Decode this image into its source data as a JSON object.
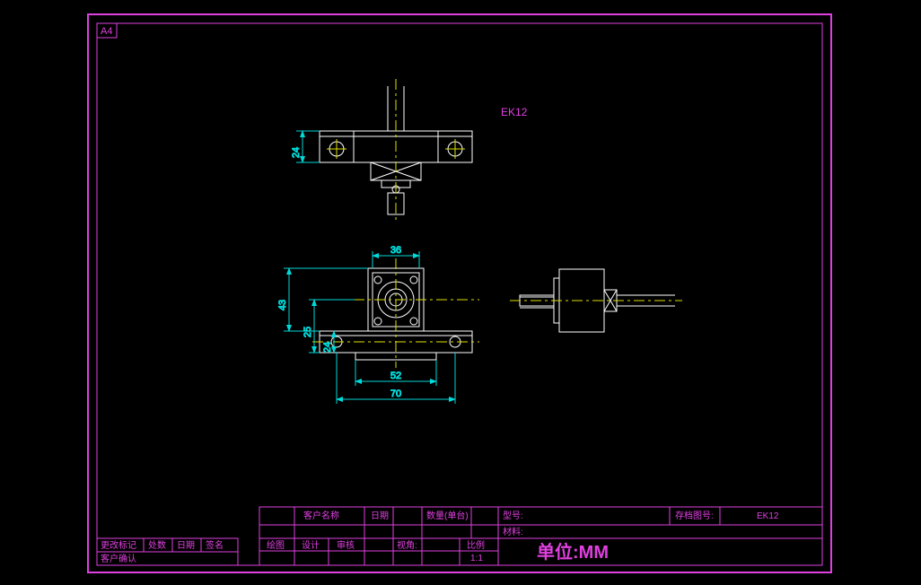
{
  "sheet": {
    "size": "A4"
  },
  "part": {
    "label_annotation": "EK12"
  },
  "dimensions": {
    "top_view_height": "24",
    "front_width_inner": "36",
    "front_height_outer": "43",
    "front_height_mid": "25",
    "front_height_inner": "24",
    "front_width_mid": "52",
    "front_width_outer": "70"
  },
  "titleblock": {
    "customer_name_label": "客户名称",
    "date_label": "日期",
    "qty_label": "数量(单台)",
    "model_label": "型号:",
    "archive_label": "存档图号:",
    "archive_value": "EK12",
    "material_label": "材料:",
    "draw_label": "绘图",
    "design_label": "设计",
    "check_label": "审核",
    "view_label": "视角:",
    "scale_label": "比例",
    "scale_value": "1:1",
    "unit_label": "单位:MM",
    "left_row1_c1": "更改标记",
    "left_row1_c2": "处数",
    "left_row1_c3": "日期",
    "left_row1_c4": "签名",
    "left_row2": "客户确认"
  }
}
